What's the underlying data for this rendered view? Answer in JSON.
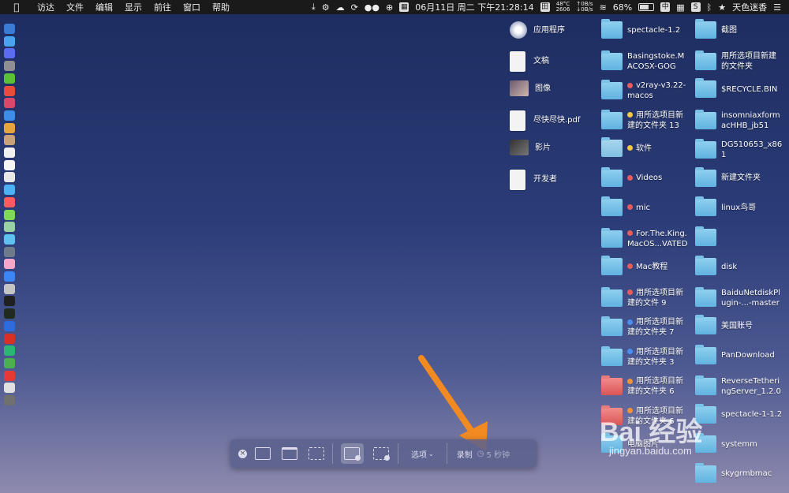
{
  "menubar": {
    "apple_icon": "apple-logo",
    "menus": [
      "访达",
      "文件",
      "编辑",
      "显示",
      "前往",
      "窗口",
      "帮助"
    ],
    "temp": "48°C",
    "rpm": "2606",
    "net_up": "↑0B/s",
    "net_down": "↓0B/s",
    "datetime": "06月11日 周二 下午21:28:14",
    "battery": "68%",
    "input_method": "中",
    "user": "天色迷香"
  },
  "desktop": {
    "col1": [
      {
        "label": "应用程序",
        "kind": "app"
      },
      {
        "label": "文稿",
        "kind": "doc"
      },
      {
        "label": "图像",
        "kind": "image"
      },
      {
        "label": "尽快尽快.pdf",
        "kind": "doc"
      },
      {
        "label": "影片",
        "kind": "movie"
      },
      {
        "label": "开发者",
        "kind": "doc"
      }
    ],
    "col2": [
      {
        "label": "spectacle-1.2",
        "tag": ""
      },
      {
        "label": "Basingstoke.M\nACOSX-GOG",
        "tag": ""
      },
      {
        "label": "v2ray-v3.22-\nmacos",
        "tag": "red"
      },
      {
        "label": "用所选项目新\n建的文件夹 13",
        "tag": "yellow"
      },
      {
        "label": "软件",
        "tag": "yellow"
      },
      {
        "label": "Videos",
        "tag": "red"
      },
      {
        "label": "mic",
        "tag": "red"
      },
      {
        "label": "For.The.King.\nMacOS...VATED",
        "tag": "red"
      },
      {
        "label": "Mac教程",
        "tag": "red"
      },
      {
        "label": "用所选项目新\n建的文件 9",
        "tag": "red"
      },
      {
        "label": "用所选项目新\n建的文件夹 7",
        "tag": "blue"
      },
      {
        "label": "用所选项目新\n建的文件夹 3",
        "tag": "blue"
      },
      {
        "label": "用所选项目新\n建的文件夹 6",
        "tag": "orange"
      },
      {
        "label": "用所选项目新\n建的文件夹 6",
        "tag": "orange"
      },
      {
        "label": "电脑图片",
        "tag": ""
      }
    ],
    "col3": [
      {
        "label": "截图"
      },
      {
        "label": "用所选项目新建\n的文件夹"
      },
      {
        "label": "$RECYCLE.BIN"
      },
      {
        "label": "insomniaxform\nacHHB_jb51"
      },
      {
        "label": "DG510653_x86\n1"
      },
      {
        "label": "新建文件夹"
      },
      {
        "label": "linux鸟哥"
      },
      {
        "label": ""
      },
      {
        "label": "disk"
      },
      {
        "label": "BaiduNetdiskPl\nugin-...-master"
      },
      {
        "label": "美国账号"
      },
      {
        "label": "PanDownload"
      },
      {
        "label": "ReverseTetheri\nngServer_1.2.0"
      },
      {
        "label": "spectacle-1-1.2"
      },
      {
        "label": "systemm"
      },
      {
        "label": "skygrmbmac"
      }
    ]
  },
  "toolbar": {
    "options_label": "选项",
    "record_label": "录制",
    "timer_label": "5 秒钟"
  },
  "watermark": {
    "brand": "Bai 经验",
    "url": "jingyan.baidu.com"
  },
  "colors": {
    "tag_red": "#e65c5c",
    "tag_yellow": "#f2c744",
    "tag_blue": "#4a8ef0",
    "tag_orange": "#f0923a",
    "arrow": "#f28a22"
  }
}
